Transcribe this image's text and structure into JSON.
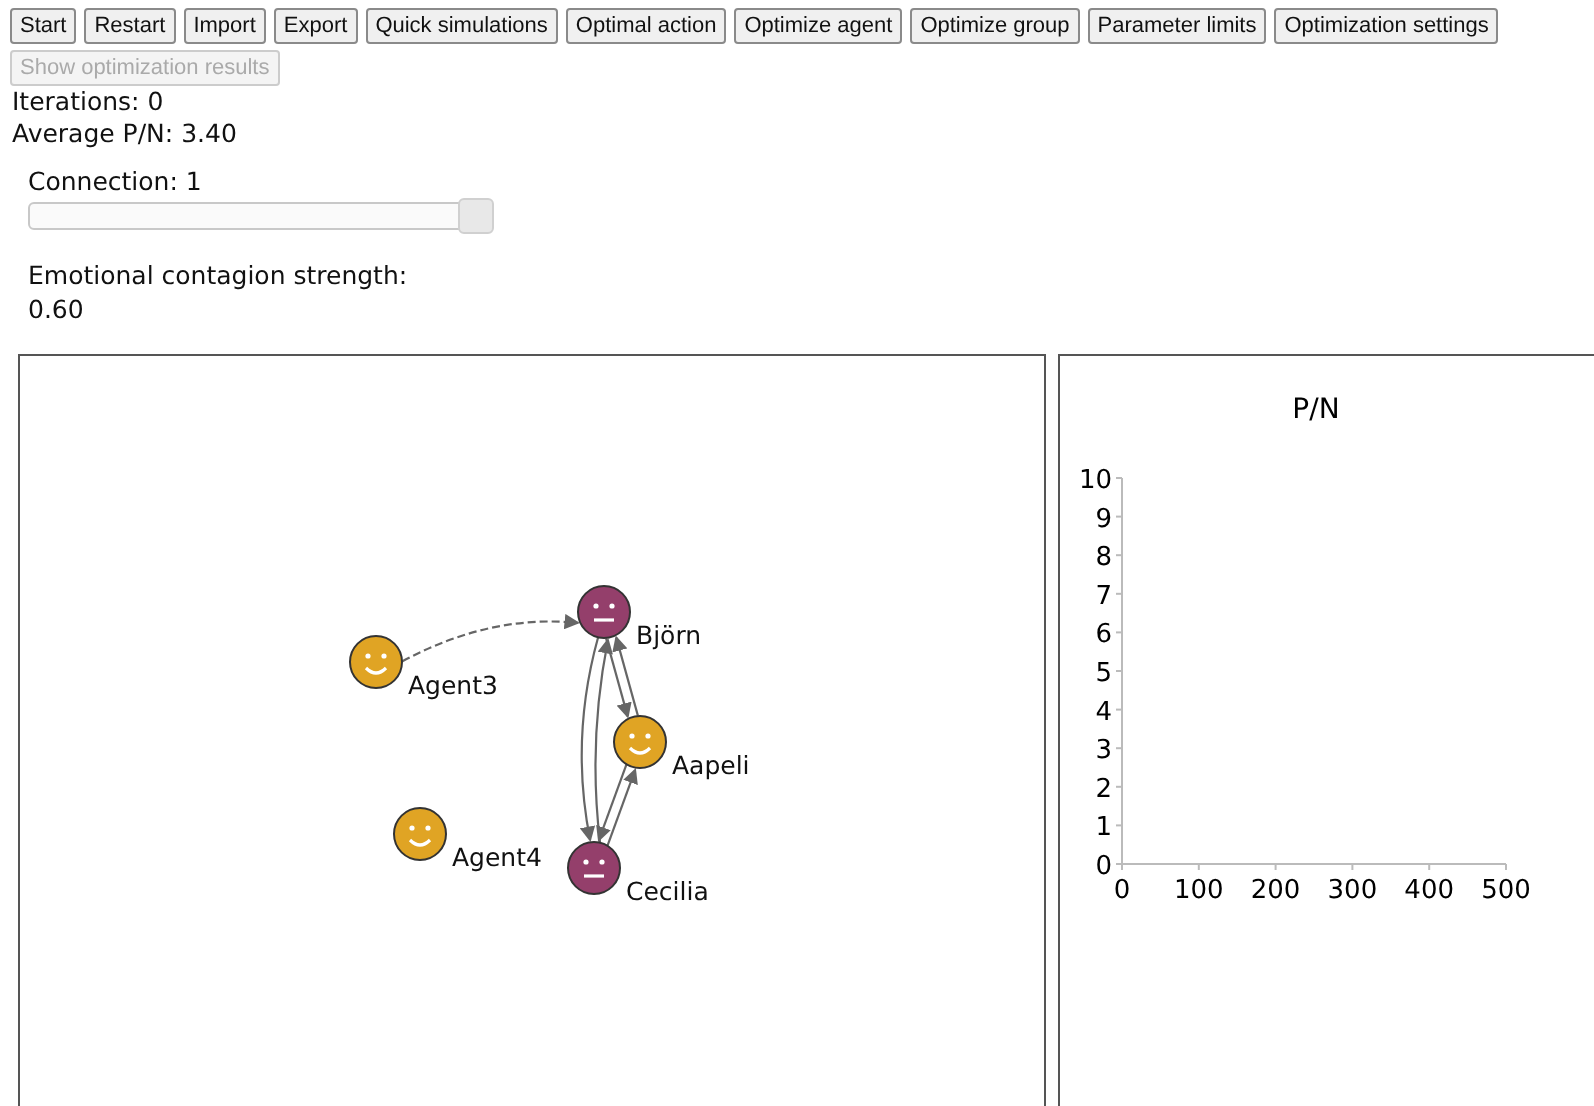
{
  "toolbar": [
    {
      "label": "Start",
      "disabled": false
    },
    {
      "label": "Restart",
      "disabled": false
    },
    {
      "label": "Import",
      "disabled": false
    },
    {
      "label": "Export",
      "disabled": false
    },
    {
      "label": "Quick simulations",
      "disabled": false
    },
    {
      "label": "Optimal action",
      "disabled": false
    },
    {
      "label": "Optimize agent",
      "disabled": false
    },
    {
      "label": "Optimize group",
      "disabled": false
    },
    {
      "label": "Parameter limits",
      "disabled": false
    },
    {
      "label": "Optimization settings",
      "disabled": false
    },
    {
      "label": "Show optimization results",
      "disabled": true
    }
  ],
  "stats": [
    "Iterations: 0",
    "Average P/N: 3.40"
  ],
  "connection": {
    "label": "Connection: 1",
    "level": 1
  },
  "contagion": {
    "label": "Emotional contagion strength:",
    "value": "0.60"
  },
  "graph": {
    "nodes": [
      {
        "name": "Björn",
        "kind": "neutral",
        "color": "#943f6b"
      },
      {
        "name": "Aapeli",
        "kind": "happy",
        "color": "#e0a424"
      },
      {
        "name": "Cecilia",
        "kind": "neutral",
        "color": "#943f6b"
      },
      {
        "name": "Agent3",
        "kind": "happy",
        "color": "#e0a424"
      },
      {
        "name": "Agent4",
        "kind": "happy",
        "color": "#e0a424"
      }
    ]
  },
  "chart": {
    "chart_data": {
      "type": "line",
      "title": "P/N",
      "xlim": [
        0,
        500
      ],
      "ylim": [
        0,
        10
      ],
      "xticks": [
        0,
        100,
        200,
        300,
        400,
        500
      ],
      "yticks": [
        0,
        1,
        2,
        3,
        4,
        5,
        6,
        7,
        8,
        9,
        10
      ]
    }
  }
}
